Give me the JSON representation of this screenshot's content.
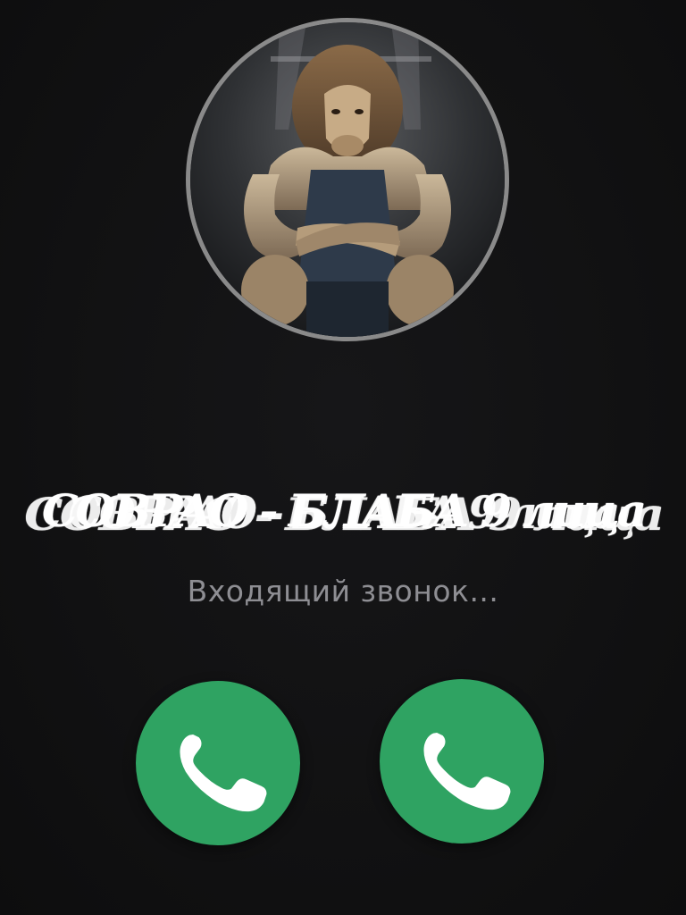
{
  "call": {
    "caller_name": "COBPAO - БЛАБА 9 лица",
    "status": "Входящий звонок..."
  },
  "avatar": {
    "icon": "lion-bodybuilder-avatar"
  },
  "buttons": [
    {
      "icon": "phone-icon",
      "action": "answer",
      "color": "#2fa362"
    },
    {
      "icon": "phone-icon",
      "action": "answer",
      "color": "#2fa362"
    }
  ],
  "colors": {
    "background": "#111112",
    "accent": "#2fa362",
    "status_text": "#8e8e93",
    "avatar_ring": "#8a8a8a"
  }
}
